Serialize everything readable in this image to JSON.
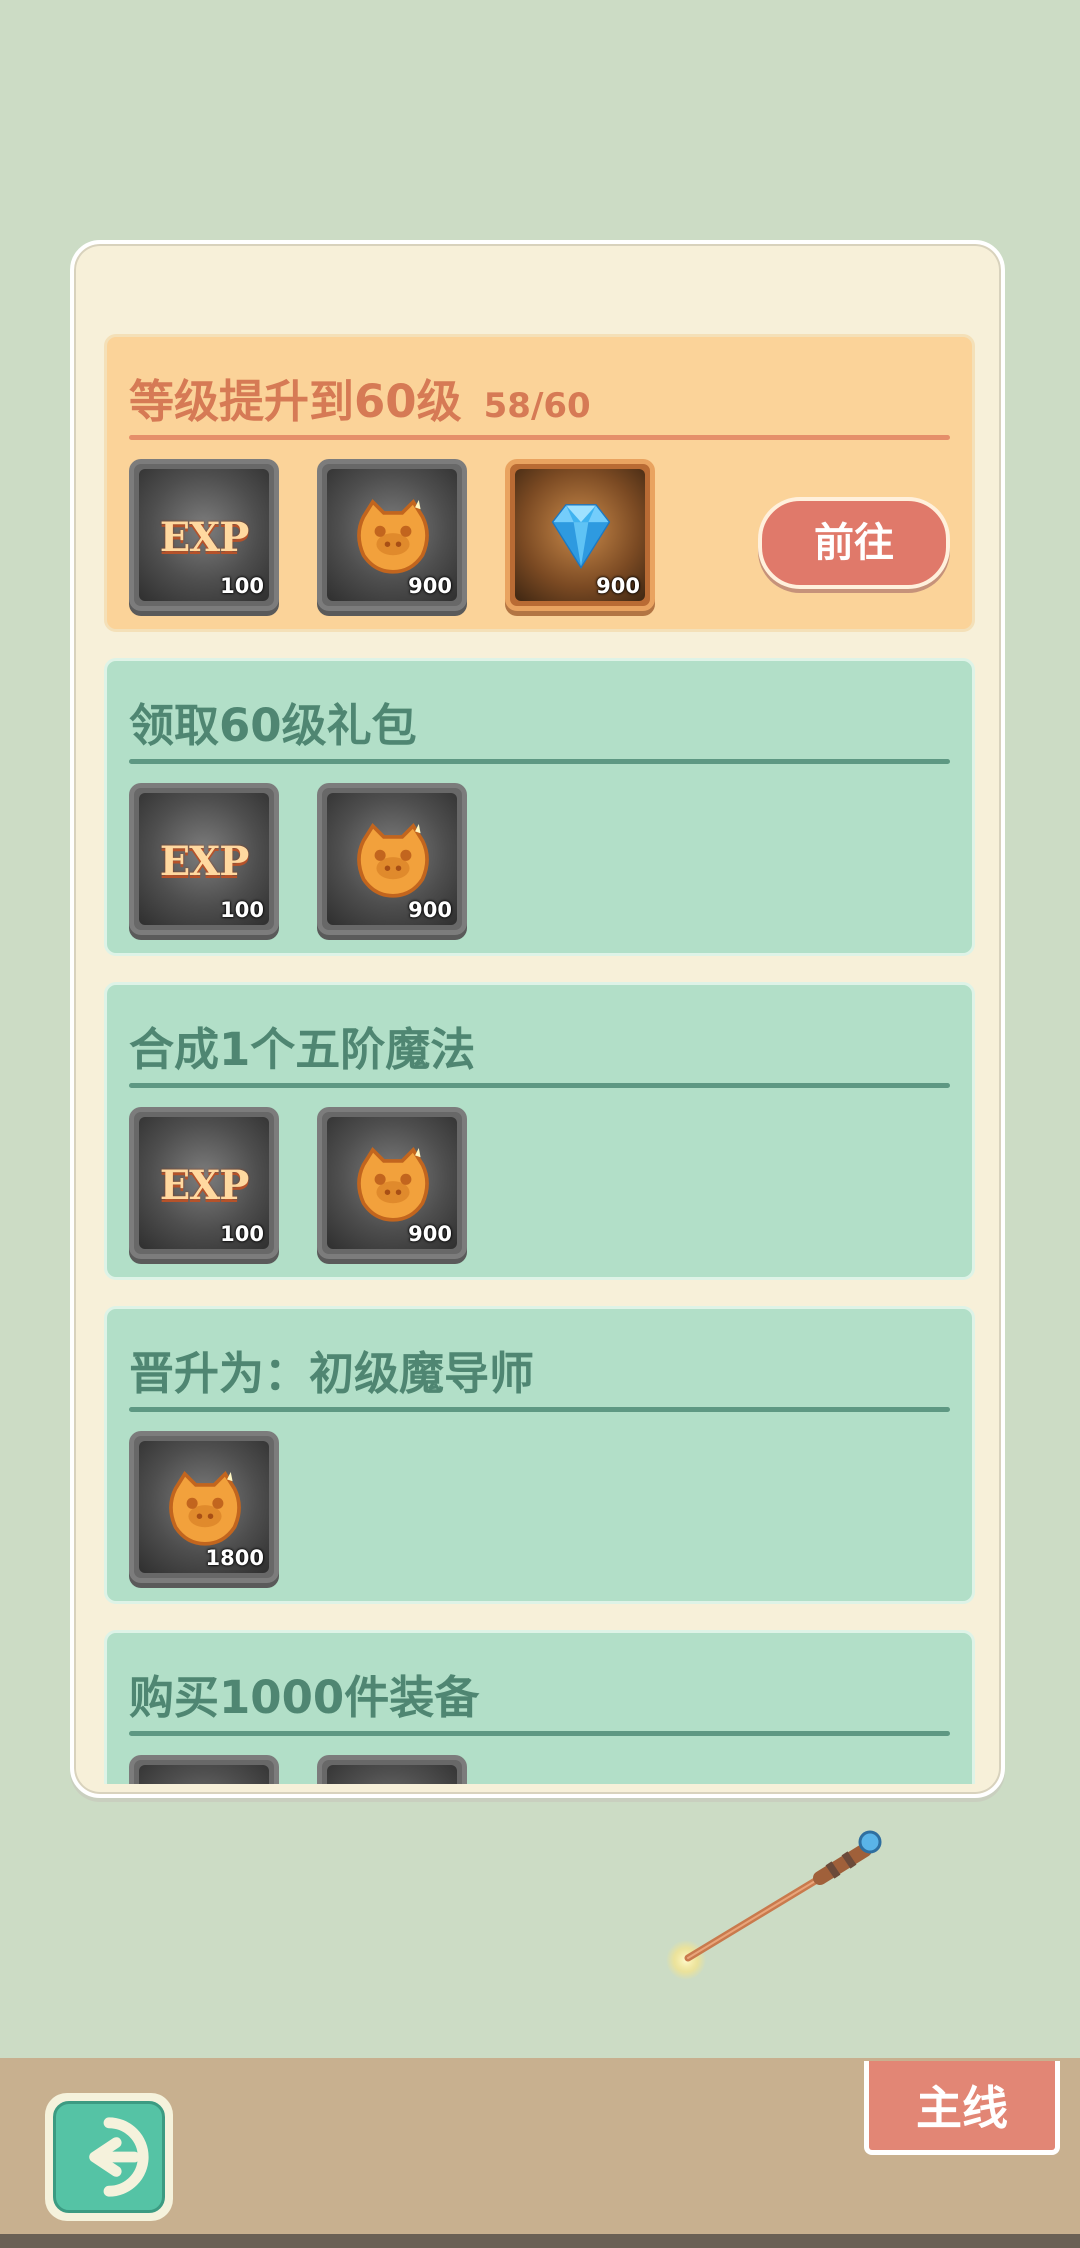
{
  "tasks": [
    {
      "title": "等级提升到60级",
      "progress": "58/60",
      "style": "highlight",
      "rewards": [
        {
          "type": "exp",
          "count": "100"
        },
        {
          "type": "coin",
          "count": "900"
        },
        {
          "type": "diamond",
          "count": "900"
        }
      ],
      "button": "前往"
    },
    {
      "title": "领取60级礼包",
      "style": "normal",
      "rewards": [
        {
          "type": "exp",
          "count": "100"
        },
        {
          "type": "coin",
          "count": "900"
        }
      ]
    },
    {
      "title": "合成1个五阶魔法",
      "style": "normal",
      "rewards": [
        {
          "type": "exp",
          "count": "100"
        },
        {
          "type": "coin",
          "count": "900"
        }
      ]
    },
    {
      "title": "晋升为：初级魔导师",
      "style": "normal",
      "rewards": [
        {
          "type": "coin",
          "count": "1800"
        }
      ]
    },
    {
      "title": "购买1000件装备",
      "style": "normal",
      "rewards": [
        {
          "type": "unknown",
          "count": ""
        },
        {
          "type": "unknown",
          "count": ""
        }
      ]
    }
  ],
  "exp_label": "EXP",
  "bottom": {
    "main_label": "主线"
  },
  "icons": {
    "back": "back-arrow-icon",
    "wand": "magic-wand-icon",
    "coin": "pig-coin-icon",
    "diamond": "diamond-icon"
  }
}
